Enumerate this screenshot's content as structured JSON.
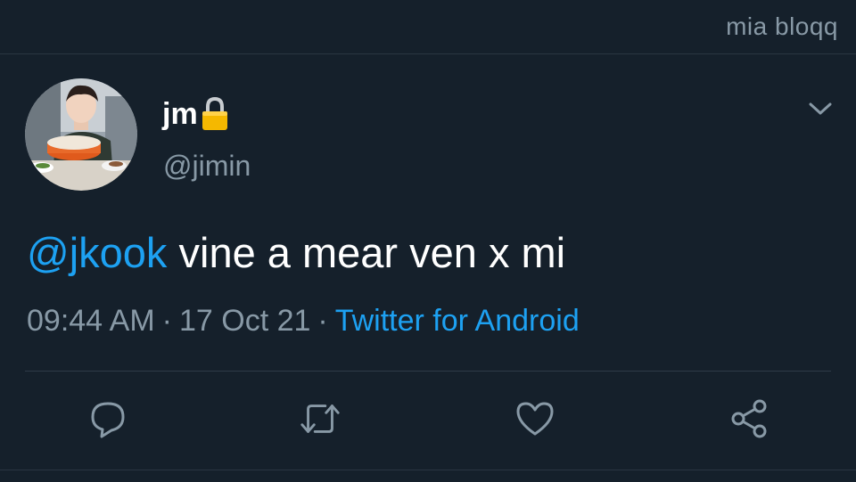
{
  "watermark": "mia bloqq",
  "tweet": {
    "display_name": "jm",
    "handle": "@jimin",
    "mention": "@jkook",
    "text": " vine a mear ven x mi",
    "time": "09:44 AM",
    "date": "17 Oct 21",
    "separator": "·",
    "source": "Twitter for Android"
  },
  "icons": {
    "lock": "lock-icon",
    "menu": "chevron-down-icon",
    "reply": "reply-icon",
    "retweet": "retweet-icon",
    "like": "heart-icon",
    "share": "share-icon"
  },
  "colors": {
    "background": "#15202b",
    "accent": "#1da1f2",
    "secondary_text": "#8899a6",
    "lock": "#f5b800"
  }
}
